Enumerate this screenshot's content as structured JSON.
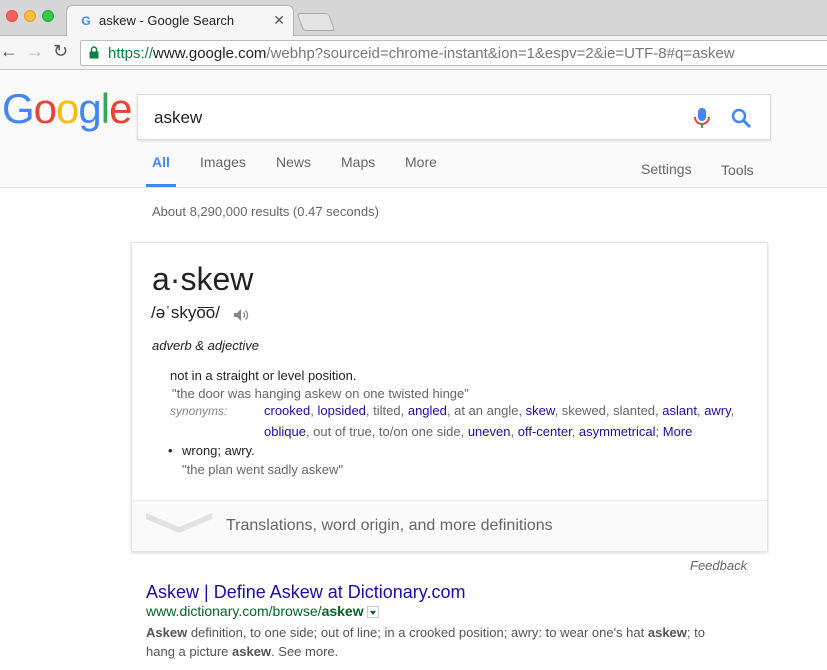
{
  "browser": {
    "tab_title": "askew - Google Search",
    "tab_close": "✕",
    "url_scheme": "https://",
    "url_host": "www.google.com",
    "url_path": "/webhp?sourceid=chrome-instant&ion=1&espv=2&ie=UTF-8#q=askew",
    "back": "←",
    "forward": "→",
    "reload": "↻"
  },
  "google": {
    "logo_letters": [
      "G",
      "o",
      "o",
      "g",
      "l",
      "e"
    ],
    "query": "askew",
    "tabs": [
      "All",
      "Images",
      "News",
      "Maps",
      "More"
    ],
    "settings": "Settings",
    "tools": "Tools",
    "stats": "About 8,290,000 results (0.47 seconds)"
  },
  "dictionary": {
    "word": "a·skew",
    "phonetic": "/əˈskyo͞o/",
    "part_of_speech": "adverb & adjective",
    "def1": "not in a straight or level position.",
    "example1": "\"the door was hanging askew on one twisted hinge\"",
    "synonyms_label": "synonyms:",
    "syn_row1": [
      {
        "t": "crooked",
        "link": true
      },
      {
        "t": ", ",
        "link": false
      },
      {
        "t": "lopsided",
        "link": true
      },
      {
        "t": ", tilted, ",
        "link": false
      },
      {
        "t": "angled",
        "link": true
      },
      {
        "t": ", at an angle, ",
        "link": false
      },
      {
        "t": "skew",
        "link": true
      },
      {
        "t": ", skewed, slanted, ",
        "link": false
      },
      {
        "t": "aslant",
        "link": true
      },
      {
        "t": ", ",
        "link": false
      },
      {
        "t": "awry",
        "link": true
      },
      {
        "t": ",",
        "link": false
      }
    ],
    "syn_row2": [
      {
        "t": "oblique",
        "link": true
      },
      {
        "t": ", out of true, to/on one side, ",
        "link": false
      },
      {
        "t": "uneven",
        "link": true
      },
      {
        "t": ", ",
        "link": false
      },
      {
        "t": "off-center",
        "link": true
      },
      {
        "t": ", ",
        "link": false
      },
      {
        "t": "asymmetrical",
        "link": true
      },
      {
        "t": ";   ",
        "link": false
      },
      {
        "t": "More",
        "link": true
      }
    ],
    "bullet": "•",
    "def2": "wrong; awry.",
    "example2": "\"the plan went sadly askew\"",
    "more_definitions": "Translations, word origin, and more definitions"
  },
  "feedback": "Feedback",
  "result": {
    "title": "Askew | Define Askew at Dictionary.com",
    "url_prefix": "www.dictionary.com/browse/",
    "url_bold": "askew",
    "snippet_parts": [
      {
        "t": "Askew",
        "b": true
      },
      {
        "t": " definition, to one side; out of line; in a crooked position; awry: to wear one's hat ",
        "b": false
      },
      {
        "t": "askew",
        "b": true
      },
      {
        "t": "; to hang a picture ",
        "b": false
      },
      {
        "t": "askew",
        "b": true
      },
      {
        "t": ". See more.",
        "b": false
      }
    ]
  }
}
